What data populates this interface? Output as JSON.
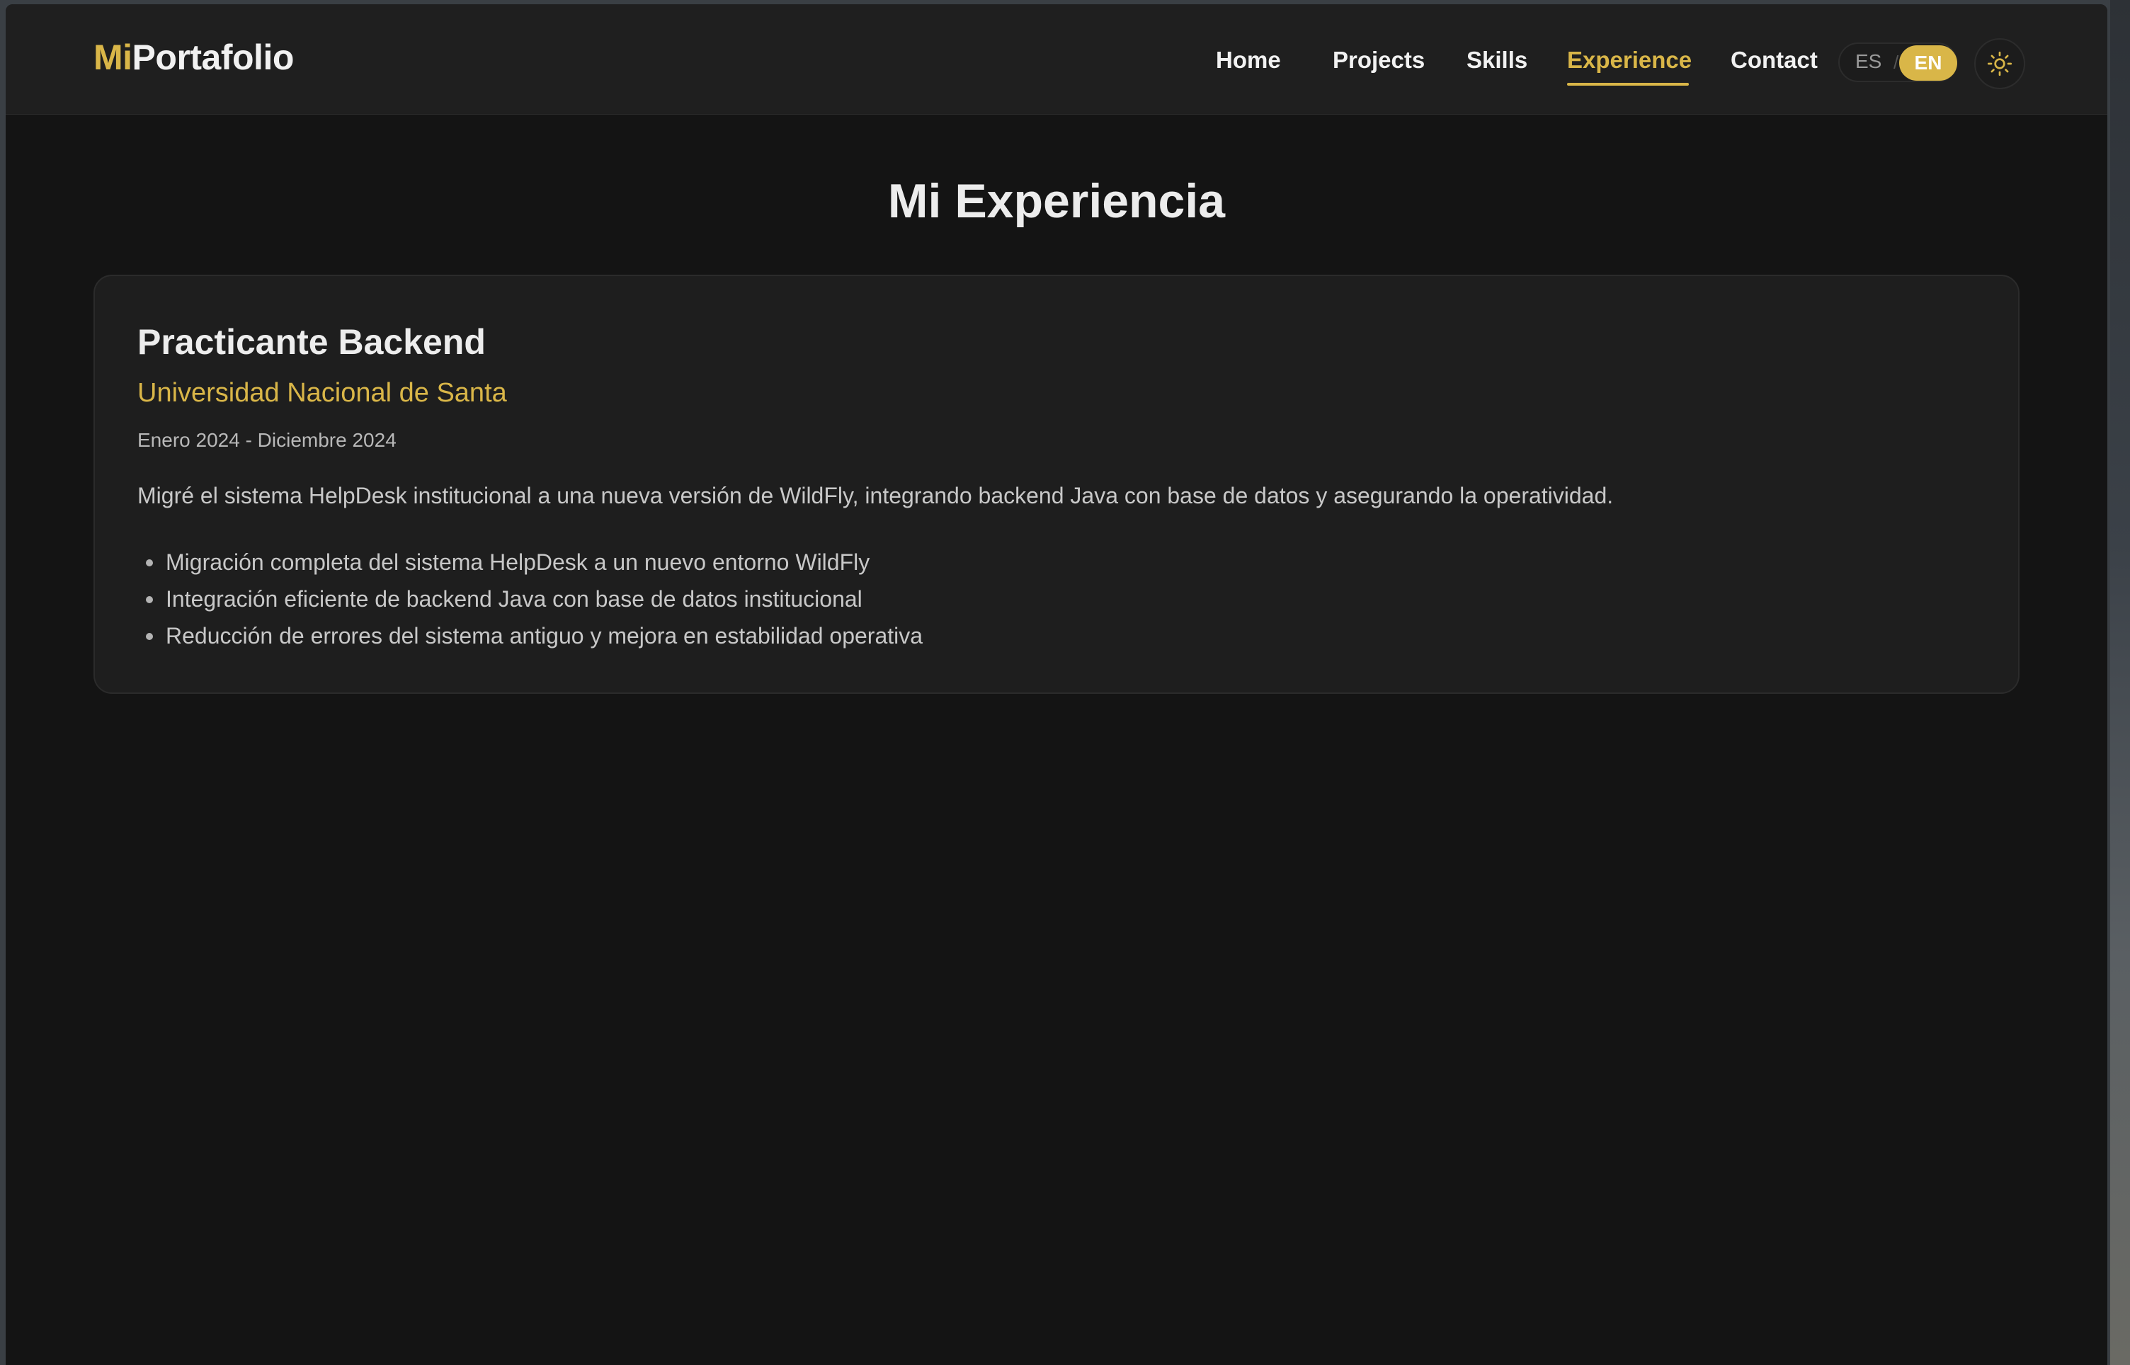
{
  "brand": {
    "accent": "Mi",
    "rest": "Portafolio"
  },
  "nav": {
    "items": [
      {
        "label": "Home"
      },
      {
        "label": "Projects"
      },
      {
        "label": "Skills"
      },
      {
        "label": "Experience",
        "active": true
      },
      {
        "label": "Contact"
      }
    ]
  },
  "lang": {
    "es": "ES",
    "separator": "/",
    "en": "EN",
    "selected": "EN"
  },
  "theme": {
    "icon": "sun-icon"
  },
  "main": {
    "title": "Mi Experiencia",
    "experience": [
      {
        "role": "Practicante Backend",
        "company": "Universidad Nacional de Santa",
        "dates": "Enero 2024 - Diciembre 2024",
        "description": "Migré el sistema HelpDesk institucional a una nueva versión de WildFly, integrando backend Java con base de datos y asegurando la operatividad.",
        "highlights": [
          "Migración completa del sistema HelpDesk a un nuevo entorno WildFly",
          "Integración eficiente de backend Java con base de datos institucional",
          "Reducción de errores del sistema antiguo y mejora en estabilidad operativa"
        ]
      }
    ]
  },
  "colors": {
    "accent": "#d9b648",
    "background": "#141414",
    "navbar": "#1f1f1f",
    "card": "#1e1e1e"
  }
}
